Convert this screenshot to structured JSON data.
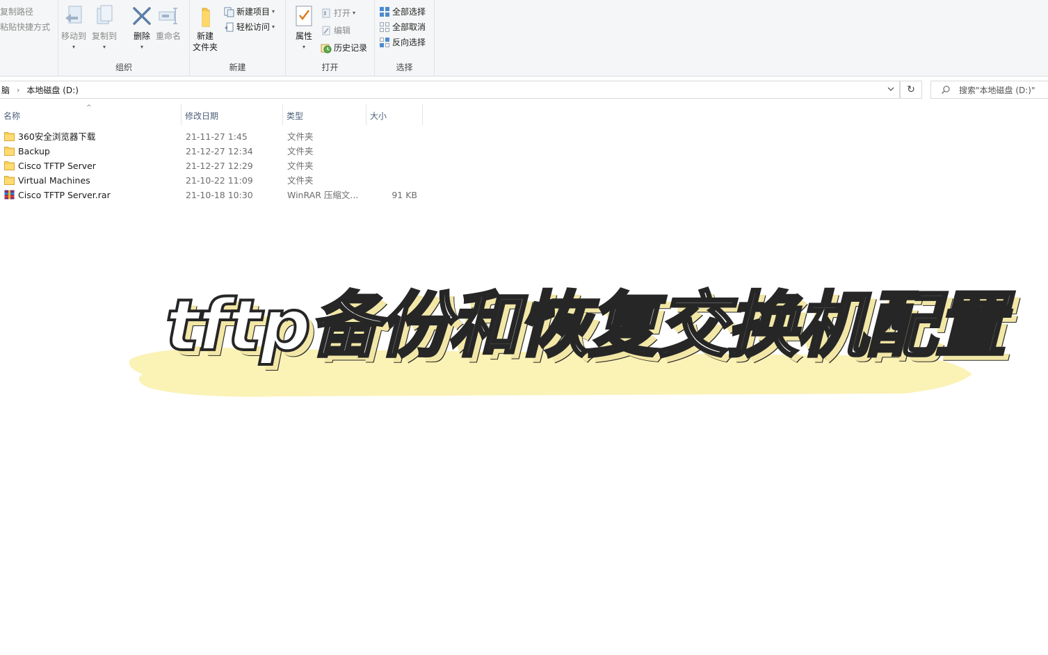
{
  "ribbon": {
    "clipboard": {
      "copy_path": "复制路径",
      "paste_shortcut": "粘贴快捷方式"
    },
    "organize": {
      "label": "组织",
      "move_to": "移动到",
      "copy_to": "复制到",
      "delete": "删除",
      "rename": "重命名"
    },
    "new": {
      "label": "新建",
      "new_folder_line1": "新建",
      "new_folder_line2": "文件夹",
      "new_item": "新建项目",
      "easy_access": "轻松访问"
    },
    "open": {
      "label": "打开",
      "properties": "属性",
      "open": "打开",
      "edit": "编辑",
      "history": "历史记录"
    },
    "select": {
      "label": "选择",
      "select_all": "全部选择",
      "select_none": "全部取消",
      "invert": "反向选择"
    }
  },
  "address": {
    "crumb_prev": "脑",
    "crumb_current": "本地磁盘 (D:)",
    "refresh_glyph": "↻",
    "search_placeholder": "搜索\"本地磁盘 (D:)\""
  },
  "columns": {
    "name": "名称",
    "date": "修改日期",
    "type": "类型",
    "size": "大小"
  },
  "files": [
    {
      "name": "360安全浏览器下载",
      "date": "21-11-27 1:45",
      "type": "文件夹",
      "size": "",
      "icon": "folder-icon"
    },
    {
      "name": "Backup",
      "date": "21-12-27 12:34",
      "type": "文件夹",
      "size": "",
      "icon": "folder-icon"
    },
    {
      "name": "Cisco TFTP Server",
      "date": "21-12-27 12:29",
      "type": "文件夹",
      "size": "",
      "icon": "folder-icon"
    },
    {
      "name": "Virtual Machines",
      "date": "21-10-22 11:09",
      "type": "文件夹",
      "size": "",
      "icon": "folder-icon"
    },
    {
      "name": "Cisco TFTP Server.rar",
      "date": "21-10-18 10:30",
      "type": "WinRAR 压缩文...",
      "size": "91 KB",
      "icon": "winrar-archive-icon"
    }
  ],
  "overlay": {
    "title": "tftp备份和恢复交换机配置",
    "brush_color": "#fbf2b6"
  }
}
